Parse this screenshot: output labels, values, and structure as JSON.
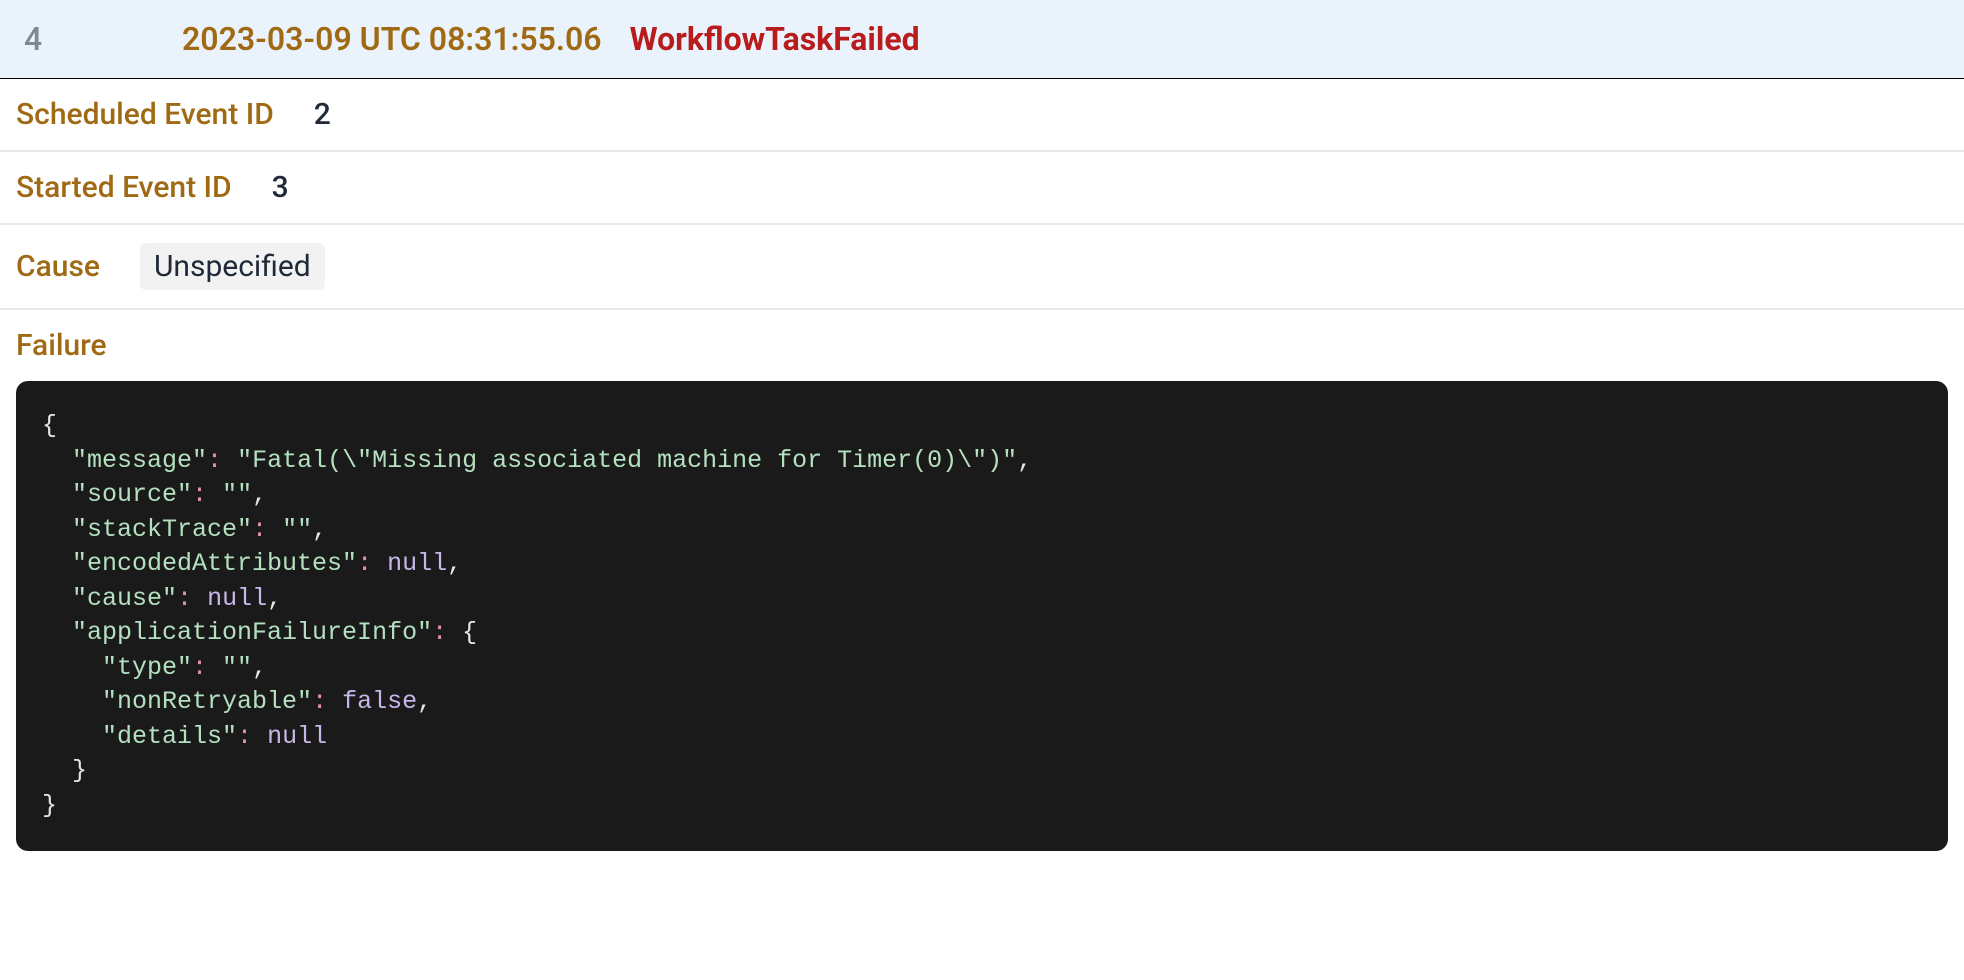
{
  "header": {
    "event_id": "4",
    "timestamp": "2023-03-09 UTC 08:31:55.06",
    "event_type": "WorkflowTaskFailed"
  },
  "details": {
    "scheduled_event_id_label": "Scheduled Event ID",
    "scheduled_event_id_value": "2",
    "started_event_id_label": "Started Event ID",
    "started_event_id_value": "3",
    "cause_label": "Cause",
    "cause_value": "Unspecified",
    "failure_label": "Failure"
  },
  "failure_json": {
    "keys": {
      "message": "\"message\"",
      "source": "\"source\"",
      "stackTrace": "\"stackTrace\"",
      "encodedAttributes": "\"encodedAttributes\"",
      "cause": "\"cause\"",
      "applicationFailureInfo": "\"applicationFailureInfo\"",
      "type": "\"type\"",
      "nonRetryable": "\"nonRetryable\"",
      "details": "\"details\""
    },
    "values": {
      "message": "\"Fatal(\\\"Missing associated machine for Timer(0)\\\")\"",
      "empty_string": "\"\"",
      "null": "null",
      "false": "false"
    },
    "punct": {
      "open_brace": "{",
      "close_brace": "}",
      "colon_sp": ": ",
      "comma": ","
    }
  }
}
